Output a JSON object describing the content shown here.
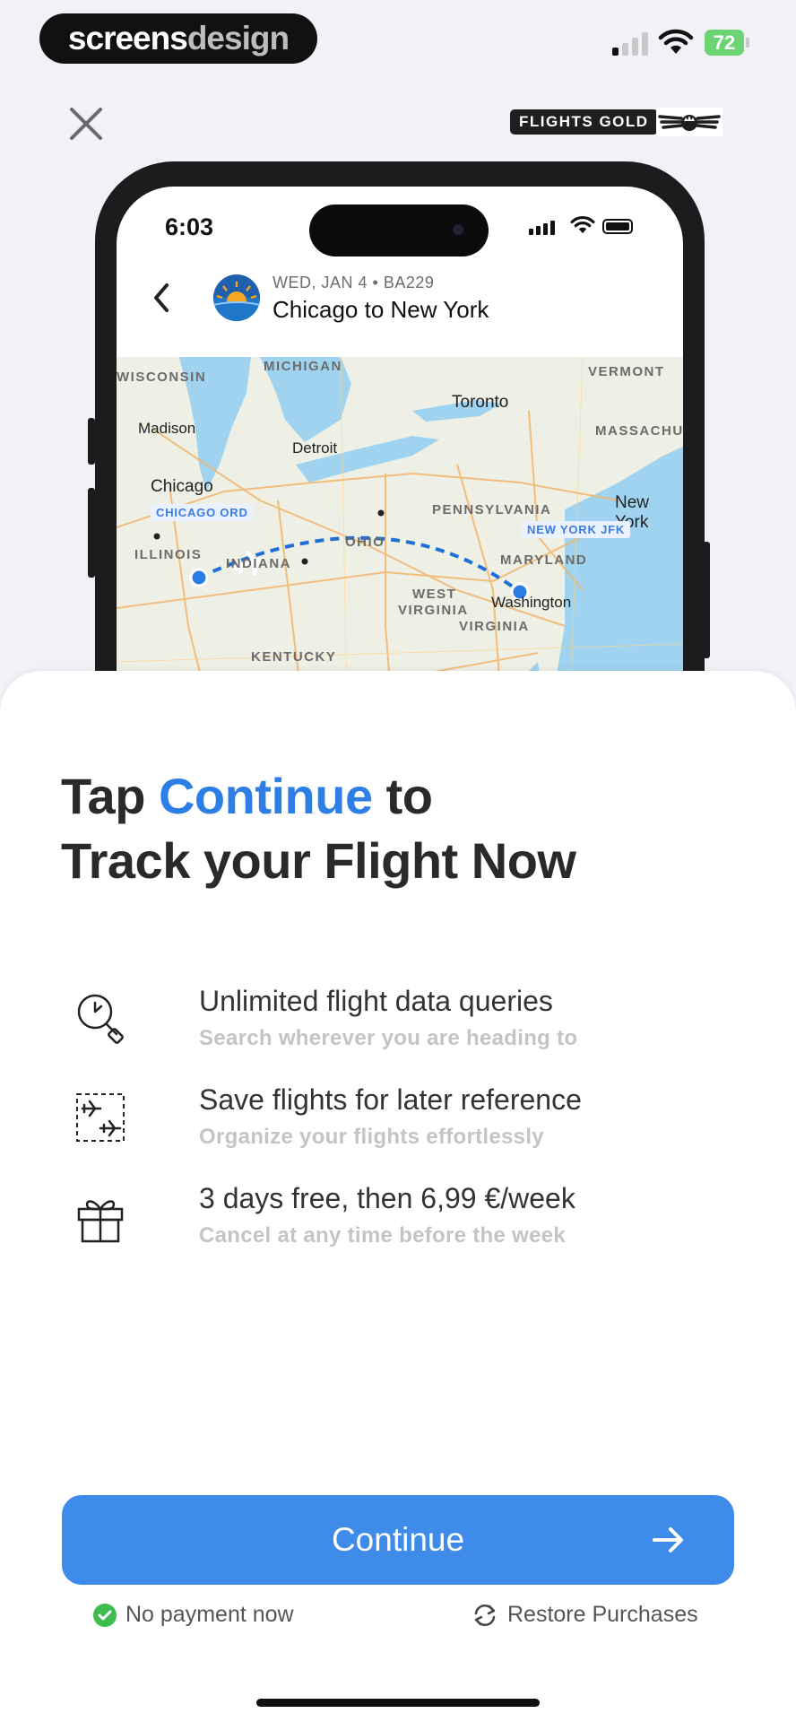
{
  "status_bar": {
    "brand_part1": "screens",
    "brand_part2": "design",
    "battery": "72"
  },
  "header": {
    "badge": "FLIGHTS GOLD"
  },
  "mockup": {
    "time": "6:03",
    "flight_meta": "WED, JAN 4 • BA229",
    "route_title": "Chicago to New York",
    "map_labels": {
      "wisconsin": "WISCONSIN",
      "michigan": "MICHIGAN",
      "vermont": "VERMONT",
      "massachusetts": "MASSACHUSE",
      "pennsylvania": "PENNSYLVANIA",
      "ohio": "OHIO",
      "illinois": "ILLINOIS",
      "indiana": "INDIANA",
      "maryland": "MARYLAND",
      "west_virginia_1": "WEST",
      "west_virginia_2": "VIRGINIA",
      "virginia": "VIRGINIA",
      "kentucky": "KENTUCKY"
    },
    "cities": {
      "toronto": "Toronto",
      "madison": "Madison",
      "detroit": "Detroit",
      "chicago": "Chicago",
      "new_york": "New York",
      "washington": "Washington"
    },
    "origin_chip": "CHICAGO  ORD",
    "destination_chip": "NEW YORK  JFK"
  },
  "headline": {
    "part1": "Tap ",
    "highlight": "Continue",
    "part2": " to",
    "line2": "Track your Flight Now"
  },
  "features": [
    {
      "icon": "search-clock-icon",
      "title": "Unlimited flight data queries",
      "subtitle": "Search wherever you are heading to"
    },
    {
      "icon": "saved-flights-icon",
      "title": "Save flights for later reference",
      "subtitle": "Organize your flights effortlessly"
    },
    {
      "icon": "gift-icon",
      "title": "3 days free, then 6,99 €/week",
      "subtitle": "Cancel at any time before the week"
    }
  ],
  "cta": {
    "label": "Continue"
  },
  "footer": {
    "no_payment": "No payment now",
    "restore": "Restore Purchases"
  },
  "colors": {
    "accent": "#3f8bea",
    "highlight": "#2d7fe6",
    "check": "#3cbd4e"
  }
}
